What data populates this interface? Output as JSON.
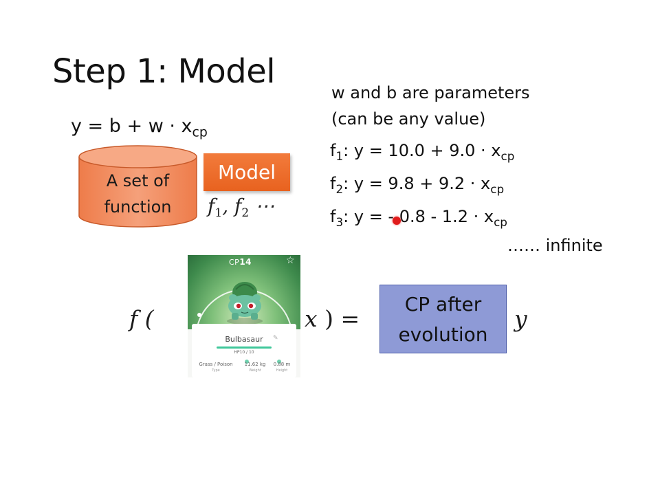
{
  "slide": {
    "title": "Step 1: Model",
    "model_equation": {
      "lhs": "y = b + w · x",
      "sub": "cp"
    },
    "set_label_line1": "A set of",
    "set_label_line2": "function",
    "model_badge": "Model",
    "function_sequence": {
      "f": "f",
      "s1": "1",
      "s2": "2",
      "ellipsis": "⋯"
    },
    "params_line1": "w and b are parameters",
    "params_line2": "(can be any value)",
    "functions": [
      {
        "name": "f",
        "index": "1",
        "body": ": y = 10.0 + 9.0 · x",
        "sub": "cp"
      },
      {
        "name": "f",
        "index": "2",
        "body": ": y = 9.8 + 9.2 · x",
        "sub": "cp"
      },
      {
        "name": "f",
        "index": "3",
        "body": ": y = - 0.8 - 1.2 · x",
        "sub": "cp"
      }
    ],
    "infinite_text": "…… infinite",
    "mapping": {
      "f_open": "f (",
      "x_close": "x",
      "paren_eq": ") =",
      "output_box_line1": "CP after",
      "output_box_line2": "evolution",
      "y": "y"
    },
    "pokemon_card": {
      "cp_prefix": "CP",
      "cp_value": "14",
      "name": "Bulbasaur",
      "hp": "HP10 / 10",
      "type": "Grass / Poison",
      "type_label": "Type",
      "weight": "11.62 kg",
      "weight_label": "Weight",
      "height": "0.88 m",
      "height_label": "Height"
    }
  },
  "colors": {
    "model_badge": "#e8621f",
    "cylinder_fill": "#f08a5d",
    "output_box_fill": "#8e9ad6",
    "pointer": "#e01b1b"
  }
}
